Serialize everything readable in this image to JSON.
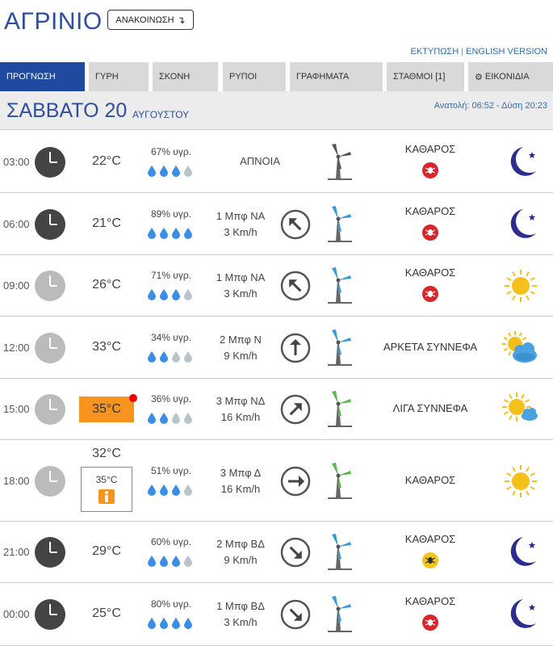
{
  "header": {
    "city": "ΑΓΡΙΝΙΟ",
    "announcement_label": "ΑΝΑΚΟΙΝΩΣΗ",
    "print_link": "ΕΚΤΥΠΩΣΗ",
    "separator": "|",
    "english_link": "ENGLISH VERSION"
  },
  "tabs": [
    {
      "label": "ΠΡΟΓΝΩΣΗ",
      "active": true
    },
    {
      "label": "ΓΥΡΗ"
    },
    {
      "label": "ΣΚΟΝΗ"
    },
    {
      "label": "ΡΥΠΟΙ"
    },
    {
      "label": "ΓΡΑΦΗΜΑΤΑ"
    },
    {
      "label": "ΣΤΑΘΜΟΙ [1]"
    },
    {
      "label": "ΕΙΚΟΝΙΔΙΑ"
    }
  ],
  "day": {
    "title": "ΣΑΒΒΑΤΟ 20",
    "month": "ΑΥΓΟΥΣΤΟΥ",
    "sunrise_sunset": "Ανατολή: 06:52 - Δύση 20:23"
  },
  "colors": {
    "brand_blue": "#2e4fa0",
    "tab_active": "#1f4aa0",
    "tab_inactive": "#d9d9d9",
    "hot_orange": "#f7941d",
    "drop_blue": "#3a8ee6",
    "drop_grey": "#b8c4cc",
    "turbine_blue": "#3a9ad9",
    "turbine_green": "#57b947",
    "moon": "#2b2e8e",
    "sun": "#f6c01b",
    "uv_red": "#d9262b",
    "uv_yellow": "#f3c619"
  },
  "forecast": [
    {
      "time": "03:00",
      "clock": "dark",
      "temp": "22°C",
      "humidity": "67% υγρ.",
      "drops": 3,
      "wind_calm": "ΑΠΝΟΙΑ",
      "wind_beaufort": "",
      "wind_speed": "",
      "wind_arrow": "none",
      "turbine": "grey",
      "sky": "ΚΑΘΑΡΟΣ",
      "uv_badge": "red",
      "icon": "moon"
    },
    {
      "time": "06:00",
      "clock": "dark",
      "temp": "21°C",
      "humidity": "89% υγρ.",
      "drops": 4,
      "wind_calm": "",
      "wind_beaufort": "1 Μπφ ΝΑ",
      "wind_speed": "3 Km/h",
      "wind_arrow": "nw",
      "turbine": "blue",
      "sky": "ΚΑΘΑΡΟΣ",
      "uv_badge": "red",
      "icon": "moon"
    },
    {
      "time": "09:00",
      "clock": "light",
      "temp": "26°C",
      "humidity": "71% υγρ.",
      "drops": 3,
      "wind_calm": "",
      "wind_beaufort": "1 Μπφ ΝΑ",
      "wind_speed": "3 Km/h",
      "wind_arrow": "nw",
      "turbine": "blue",
      "sky": "ΚΑΘΑΡΟΣ",
      "uv_badge": "red",
      "icon": "sun"
    },
    {
      "time": "12:00",
      "clock": "light",
      "temp": "33°C",
      "humidity": "34% υγρ.",
      "drops": 2,
      "wind_calm": "",
      "wind_beaufort": "2 Μπφ Ν",
      "wind_speed": "9 Km/h",
      "wind_arrow": "n",
      "turbine": "blue",
      "sky": "ΑΡΚΕΤΑ ΣΥΝΝΕΦΑ",
      "uv_badge": "",
      "icon": "sun-clouds"
    },
    {
      "time": "15:00",
      "clock": "light",
      "temp": "35°C",
      "hot": true,
      "humidity": "36% υγρ.",
      "drops": 2,
      "wind_calm": "",
      "wind_beaufort": "3 Μπφ ΝΔ",
      "wind_speed": "16 Km/h",
      "wind_arrow": "ne",
      "turbine": "green",
      "sky": "ΛΙΓΑ ΣΥΝΝΕΦΑ",
      "uv_badge": "",
      "icon": "sun-cloud"
    },
    {
      "time": "18:00",
      "clock": "light",
      "temp": "32°C",
      "feels": "35°C",
      "humidity": "51% υγρ.",
      "drops": 3,
      "wind_calm": "",
      "wind_beaufort": "3 Μπφ Δ",
      "wind_speed": "16 Km/h",
      "wind_arrow": "e",
      "turbine": "green",
      "sky": "ΚΑΘΑΡΟΣ",
      "uv_badge": "",
      "icon": "sun"
    },
    {
      "time": "21:00",
      "clock": "dark",
      "temp": "29°C",
      "humidity": "60% υγρ.",
      "drops": 3,
      "wind_calm": "",
      "wind_beaufort": "2 Μπφ ΒΔ",
      "wind_speed": "9 Km/h",
      "wind_arrow": "se",
      "turbine": "blue",
      "sky": "ΚΑΘΑΡΟΣ",
      "uv_badge": "yellow",
      "icon": "moon"
    },
    {
      "time": "00:00",
      "clock": "dark",
      "temp": "25°C",
      "humidity": "80% υγρ.",
      "drops": 4,
      "wind_calm": "",
      "wind_beaufort": "1 Μπφ ΒΔ",
      "wind_speed": "3 Km/h",
      "wind_arrow": "se",
      "turbine": "blue",
      "sky": "ΚΑΘΑΡΟΣ",
      "uv_badge": "red",
      "icon": "moon"
    }
  ]
}
